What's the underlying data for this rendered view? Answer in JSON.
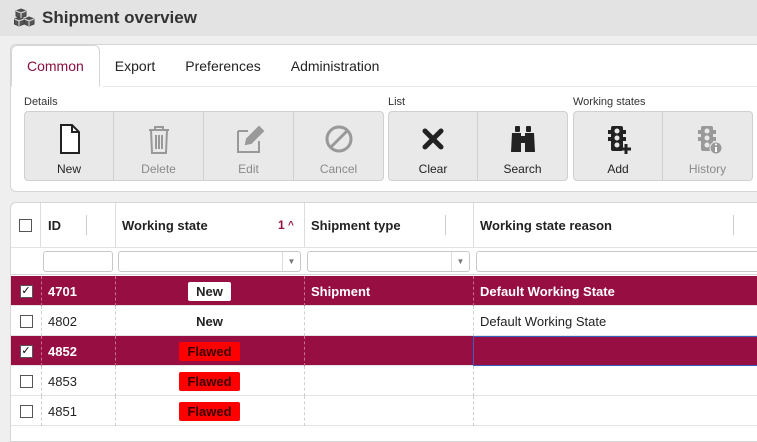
{
  "title": "Shipment overview",
  "tabs": [
    "Common",
    "Export",
    "Preferences",
    "Administration"
  ],
  "groups": {
    "details": "Details",
    "list": "List",
    "working_states": "Working states"
  },
  "buttons": {
    "new": "New",
    "delete": "Delete",
    "edit": "Edit",
    "cancel": "Cancel",
    "clear": "Clear",
    "search": "Search",
    "add": "Add",
    "history": "History"
  },
  "columns": {
    "id": "ID",
    "working_state": "Working state",
    "sort_index": "1",
    "shipment_type": "Shipment type",
    "working_state_reason": "Working state reason"
  },
  "rows": [
    {
      "id": "4701",
      "state": "New",
      "state_style": "new",
      "type": "Shipment",
      "reason": "Default Working State",
      "selected": true
    },
    {
      "id": "4802",
      "state": "New",
      "state_style": "new",
      "type": "",
      "reason": "Default Working State",
      "selected": false
    },
    {
      "id": "4852",
      "state": "Flawed",
      "state_style": "flawed",
      "type": "",
      "reason": "",
      "selected": true
    },
    {
      "id": "4853",
      "state": "Flawed",
      "state_style": "flawed",
      "type": "",
      "reason": "",
      "selected": false
    },
    {
      "id": "4851",
      "state": "Flawed",
      "state_style": "flawed",
      "type": "",
      "reason": "",
      "selected": false
    }
  ],
  "colors": {
    "accent": "#8a0e3e",
    "selected_row": "#970e43",
    "flawed": "#ff0000"
  }
}
